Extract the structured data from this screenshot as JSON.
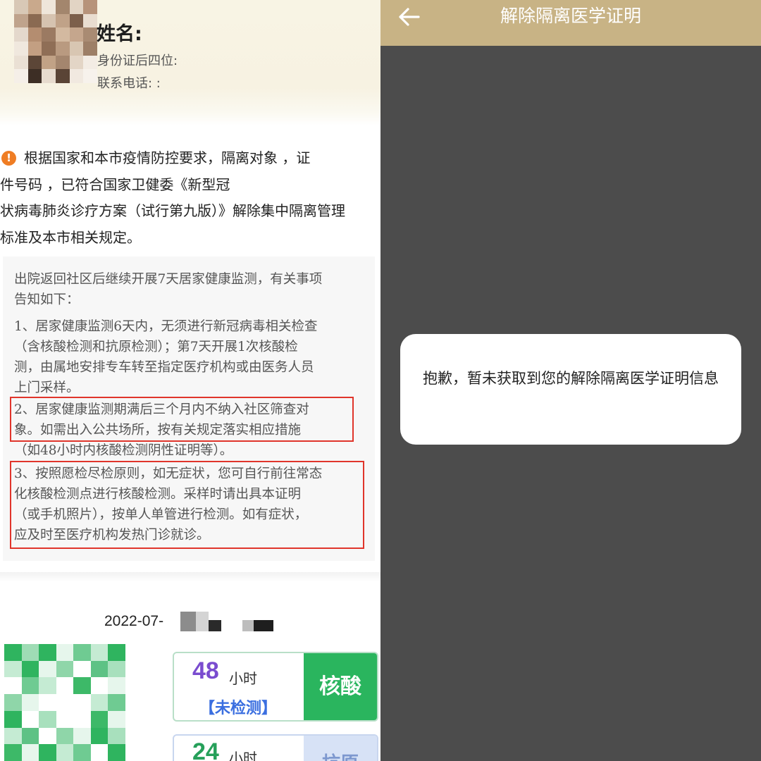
{
  "profile": {
    "name_label": "姓名:",
    "id_label": "身份证后四位:",
    "phone_label": "联系电话: :"
  },
  "notice": {
    "lines": [
      "根据国家和本市疫情防控要求，隔离对象          ，证",
      "件号码                           ，已符合国家卫健委《新型冠",
      "状病毒肺炎诊疗方案（试行第九版）》解除集中隔离管理",
      "标准及本市相关规定。"
    ]
  },
  "tips": {
    "intro": [
      "出院返回社区后继续开展7天居家健康监测，有关事项",
      "告知如下："
    ],
    "item1": [
      "1、居家健康监测6天内，无须进行新冠病毒相关检查",
      "（含核酸检测和抗原检测）；第7天开展1次核酸检",
      "测，由属地安排专车转至指定医疗机构或由医务人员",
      "上门采样。"
    ],
    "item2": [
      "2、居家健康监测期满后三个月内不纳入社区筛查对",
      "象。如需出入公共场所，按有关规定落实相应措施",
      "（如48小时内核酸检测阴性证明等）。"
    ],
    "item3": [
      "3、按照愿检尽检原则，如无症状，您可自行前往常态",
      "化核酸检测点进行核酸检测。采样时请出具本证明",
      "（或手机照片），按单人单管进行检测。如有症状，",
      "应及时至医疗机构发热门诊就诊。"
    ]
  },
  "test_date": "2022-07-",
  "cards": [
    {
      "hours": "48",
      "unit": "小时",
      "status": "【未检测】",
      "tag": "核酸"
    },
    {
      "hours": "24",
      "unit": "小时",
      "status": "",
      "tag": "抗原"
    }
  ],
  "header": {
    "title": "解除隔离医学证明",
    "back_icon": "arrow-left-icon"
  },
  "dialog": {
    "message": "抱歉，暂未获取到您的解除隔离医学证明信息"
  },
  "colors": {
    "header_bg": "#c8b385",
    "overlay_bg": "#4c4c4c",
    "warning": "#ef7d24",
    "highlight_box": "#e0352b",
    "nucleic_tag": "#2ab55e",
    "status_blue": "#3b6fe0",
    "hours_purple": "#7a4ccf"
  }
}
